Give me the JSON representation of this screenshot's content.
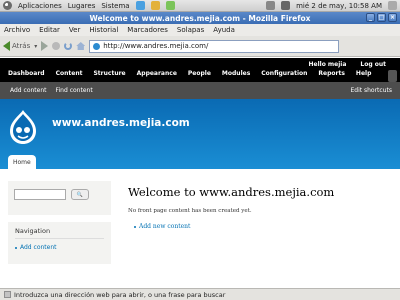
{
  "panel": {
    "menus": [
      "Aplicaciones",
      "Lugares",
      "Sistema"
    ],
    "clock": "mié  2 de may, 10:58 AM"
  },
  "browser": {
    "title": "Welcome to www.andres.mejia.com - Mozilla Firefox",
    "menus": [
      "Archivo",
      "Editar",
      "Ver",
      "Historial",
      "Marcadores",
      "Solapas",
      "Ayuda"
    ],
    "back_label": "Atrás",
    "url": "http://www.andres.mejia.com/",
    "status": "Introduzca una dirección web para abrir, o una frase para buscar"
  },
  "toolbar": {
    "items": [
      "Dashboard",
      "Content",
      "Structure",
      "Appearance",
      "People",
      "Modules",
      "Configuration",
      "Reports",
      "Help"
    ],
    "greeting": "Hello mejia",
    "logout": "Log out",
    "shortcuts": [
      "Add content",
      "Find content"
    ],
    "edit_shortcuts": "Edit shortcuts"
  },
  "site": {
    "name": "www.andres.mejia.com",
    "tab_home": "Home"
  },
  "sidebar": {
    "search_button": "🔍",
    "nav_title": "Navigation",
    "nav_links": [
      "Add content"
    ]
  },
  "main": {
    "title": "Welcome to www.andres.mejia.com",
    "intro": "No front page content has been created yet.",
    "links": [
      "Add new content"
    ]
  },
  "colors": {
    "header": "#0a6ab3",
    "link": "#0071b3",
    "toolbar": "#000000"
  }
}
